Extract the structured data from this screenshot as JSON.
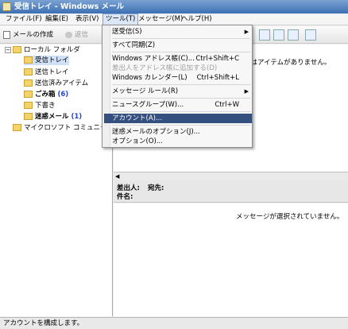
{
  "window": {
    "title": "受信トレイ - Windows メール",
    "icon": "mail-icon"
  },
  "menubar": {
    "items": [
      {
        "label": "ファイル(F)"
      },
      {
        "label": "編集(E)"
      },
      {
        "label": "表示(V)"
      },
      {
        "label": "ツール(T)",
        "active": true
      },
      {
        "label": "メッセージ(M)"
      },
      {
        "label": "ヘルプ(H)"
      }
    ]
  },
  "toolbar": {
    "compose_label": "メールの作成",
    "reply_label": "返信"
  },
  "tools_menu": {
    "items": [
      {
        "label": "送受信(S)",
        "submenu": true
      },
      {
        "label": "すべて同期(Z)"
      },
      {
        "label": "Windows アドレス帳(C)...",
        "shortcut": "Ctrl+Shift+C"
      },
      {
        "label": "差出人をアドレス帳に追加する(D)",
        "disabled": true
      },
      {
        "label": "Windows カレンダー(L)",
        "shortcut": "Ctrl+Shift+L"
      },
      {
        "label": "メッセージ ルール(R)",
        "submenu": true
      },
      {
        "label": "ニュースグループ(W)...",
        "shortcut": "Ctrl+W"
      },
      {
        "label": "アカウント(A)...",
        "highlighted": true
      },
      {
        "label": "迷惑メールのオプション(J)..."
      },
      {
        "label": "オプション(O)..."
      }
    ]
  },
  "folders": {
    "expand_glyph": "−",
    "local_label": "ローカル フォルダ",
    "items": [
      {
        "label": "受信トレイ",
        "selected": true
      },
      {
        "label": "送信トレイ"
      },
      {
        "label": "送信済みアイテム"
      },
      {
        "label": "ごみ箱",
        "count": "(6)"
      },
      {
        "label": "下書き"
      },
      {
        "label": "迷惑メール",
        "count": "(1)"
      }
    ],
    "community_label": "マイクロソフト コミュニティ"
  },
  "list": {
    "empty_message": "ューにはアイテムがありません。"
  },
  "preview": {
    "from_label": "差出人:",
    "to_label": "宛先:",
    "subject_label": "件名:",
    "no_selection": "メッセージが選択されていません。"
  },
  "status": {
    "text": "アカウントを構成します。"
  },
  "colors": {
    "menu_highlight": "#33507f",
    "titlebar": "#3d6fb3",
    "count_blue": "#2a46c8"
  }
}
